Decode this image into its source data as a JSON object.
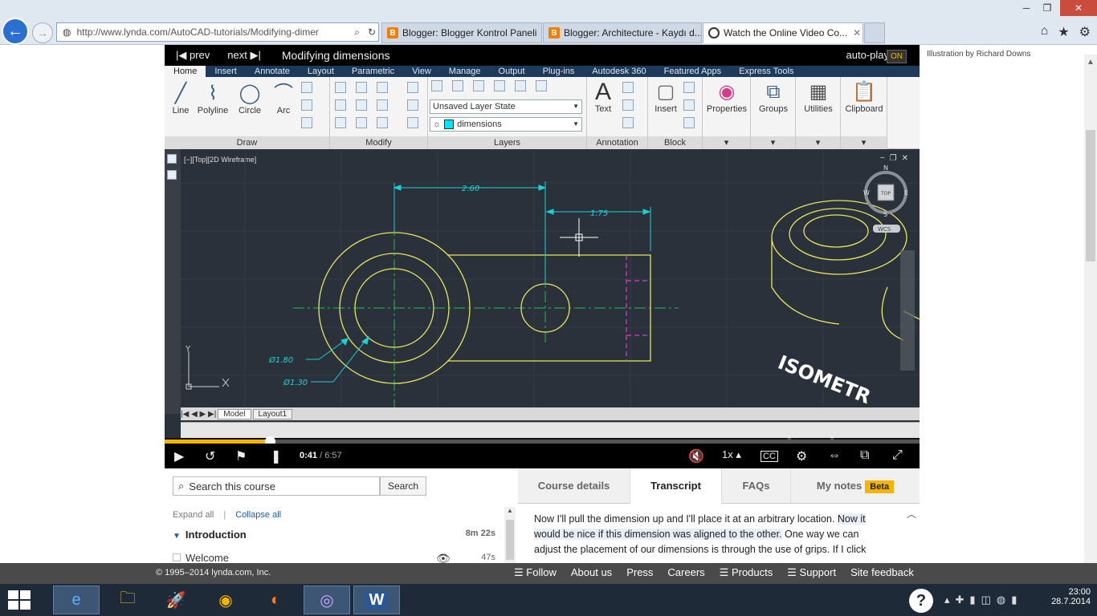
{
  "browser": {
    "url": "http://www.lynda.com/AutoCAD-tutorials/Modifying-dimer",
    "tabs": [
      {
        "label": "Blogger: Blogger Kontrol Paneli",
        "icon": "blogger-icon"
      },
      {
        "label": "Blogger: Architecture - Kaydı d...",
        "icon": "blogger-icon"
      },
      {
        "label": "Watch the Online Video Co...",
        "icon": "globe-icon",
        "active": true
      }
    ]
  },
  "credit": "Illustration by Richard Downs",
  "player": {
    "prev_label": "prev",
    "next_label": "next",
    "title": "Modifying dimensions",
    "autoplay_label": "auto-play",
    "autoplay_state": "ON",
    "time_current": "0:41",
    "time_total": "/ 6:57",
    "progress": 0.139,
    "speed": "1x",
    "watermark": "lynda.com"
  },
  "ribbon": {
    "tabs": [
      "Home",
      "Insert",
      "Annotate",
      "Layout",
      "Parametric",
      "View",
      "Manage",
      "Output",
      "Plug-ins",
      "Autodesk 360",
      "Featured Apps",
      "Express Tools"
    ],
    "draw_tools": [
      "Line",
      "Polyline",
      "Circle",
      "Arc"
    ],
    "panels": [
      "Draw",
      "Modify",
      "Layers",
      "Annotation",
      "Block"
    ],
    "layer_state": "Unsaved Layer State",
    "layer_name": "dimensions",
    "text_label": "Text",
    "insert_label": "Insert",
    "big_tools": [
      "Properties",
      "Groups",
      "Utilities",
      "Clipboard"
    ]
  },
  "drawing": {
    "viewport_label": "[−][Top][2D Wireframe]",
    "dim1": "2.60",
    "dim2": "1.75",
    "dia1": "Ø1.80",
    "dia2": "Ø1.30",
    "iso_text": "ISOMETR",
    "compass": {
      "n": "N",
      "w": "W",
      "e": "E",
      "s": "S",
      "top": "TOP",
      "wcs": "WCS"
    },
    "layout_tabs": [
      "Model",
      "Layout1"
    ],
    "y_axis": "Y"
  },
  "search": {
    "placeholder": "Search this course",
    "button": "Search"
  },
  "toc": {
    "expand_all": "Expand all",
    "collapse_all": "Collapse all",
    "chapter": {
      "title": "Introduction",
      "duration": "8m 22s"
    },
    "item": {
      "title": "Welcome",
      "duration": "47s"
    }
  },
  "info_tabs": {
    "course_details": "Course details",
    "transcript": "Transcript",
    "faqs": "FAQs",
    "my_notes": "My notes",
    "beta": "Beta"
  },
  "transcript": {
    "part1": "Now I'll pull the dimension up and I'll place it at an arbitrary location. ",
    "part2": "Now it would be nice if this dimension was aligned to the other.",
    "part3": " One way we can adjust the placement of our dimensions is through the use of grips. If I click"
  },
  "footer": {
    "copyright": "© 1995–2014 lynda.com, Inc.",
    "links": [
      "Follow",
      "About us",
      "Press",
      "Careers",
      "Products",
      "Support",
      "Site feedback"
    ]
  },
  "taskbar": {
    "time": "23:00",
    "date": "28.7.2014"
  },
  "colors": {
    "accent": "#f5b400",
    "cad_bg": "#2b313b",
    "cad_geometry": "#e5e55a",
    "cad_dimension": "#19d3d3",
    "cad_centerline": "#1fbf4a"
  }
}
